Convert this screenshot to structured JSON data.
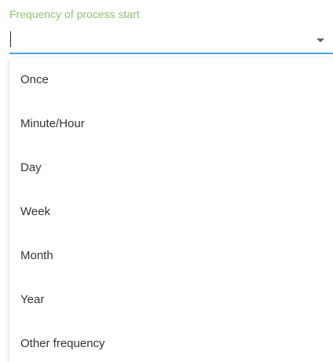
{
  "field": {
    "label": "Frequency of process start",
    "value": "",
    "label_color": "#8cc56a",
    "focus_color": "#4aa3df"
  },
  "menu": {
    "items": [
      {
        "label": "Once"
      },
      {
        "label": "Minute/Hour"
      },
      {
        "label": "Day"
      },
      {
        "label": "Week"
      },
      {
        "label": "Month"
      },
      {
        "label": "Year"
      },
      {
        "label": "Other frequency"
      }
    ]
  },
  "icons": {
    "dropdown": "chevron-down-icon"
  }
}
